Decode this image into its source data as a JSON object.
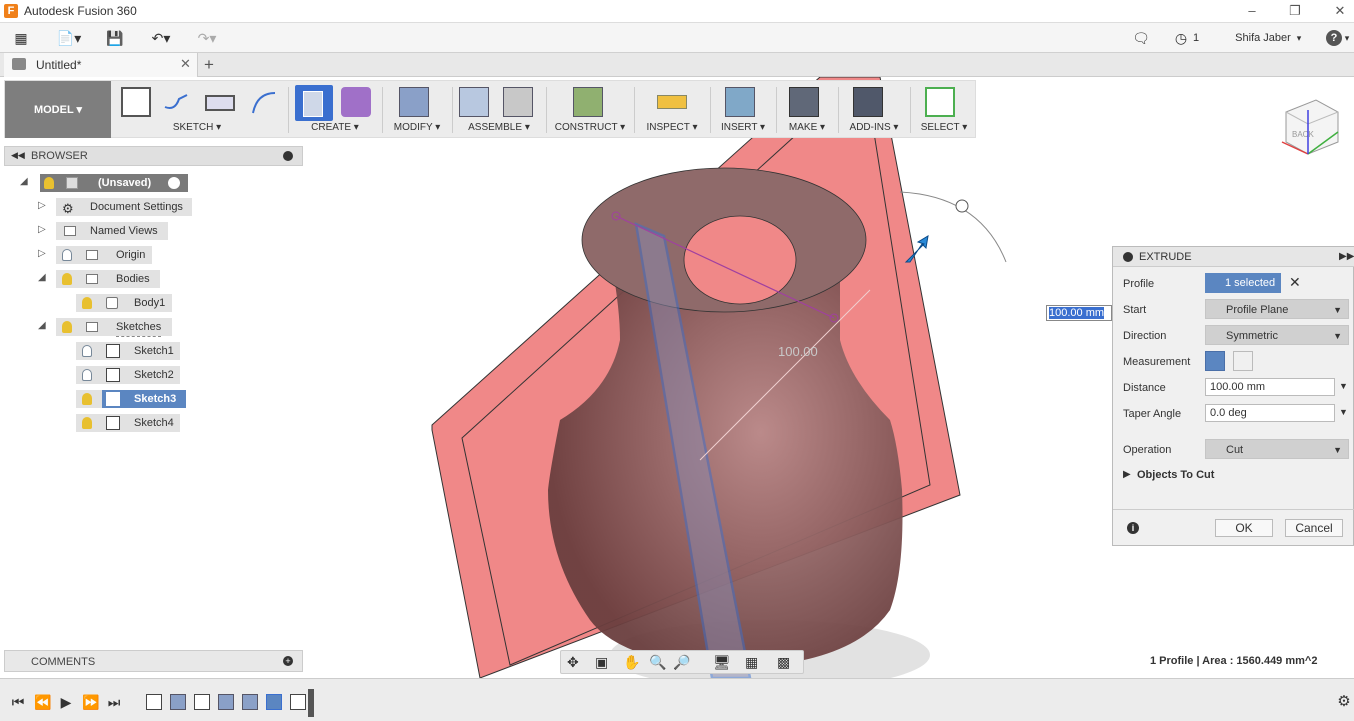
{
  "window": {
    "title": "Autodesk Fusion 360",
    "logo": "F"
  },
  "appbar": {
    "notifications_count": "1",
    "user": "Shifa Jaber",
    "help": "?"
  },
  "document": {
    "tab_title": "Untitled*"
  },
  "toolbar": {
    "workspace": "MODEL",
    "groups": [
      "SKETCH",
      "CREATE",
      "MODIFY",
      "ASSEMBLE",
      "CONSTRUCT",
      "INSPECT",
      "INSERT",
      "MAKE",
      "ADD-INS",
      "SELECT"
    ]
  },
  "browser": {
    "header": "BROWSER",
    "root": "(Unsaved)",
    "items": {
      "document_settings": "Document Settings",
      "named_views": "Named Views",
      "origin": "Origin",
      "bodies": "Bodies",
      "body1": "Body1",
      "sketches": "Sketches",
      "sketch1": "Sketch1",
      "sketch2": "Sketch2",
      "sketch3": "Sketch3",
      "sketch4": "Sketch4"
    }
  },
  "comments": {
    "header": "COMMENTS"
  },
  "extrude": {
    "title": "EXTRUDE",
    "profile_label": "Profile",
    "profile_value": "1 selected",
    "start_label": "Start",
    "start_value": "Profile Plane",
    "direction_label": "Direction",
    "direction_value": "Symmetric",
    "measurement_label": "Measurement",
    "distance_label": "Distance",
    "distance_value": "100.00 mm",
    "taper_label": "Taper Angle",
    "taper_value": "0.0 deg",
    "operation_label": "Operation",
    "operation_value": "Cut",
    "objects_label": "Objects To Cut",
    "ok": "OK",
    "cancel": "Cancel"
  },
  "viewport": {
    "dim_input": "100.00 mm",
    "dim_label": "100.00",
    "status": "1 Profile | Area : 1560.449 mm^2",
    "viewcube_face": "BACK"
  },
  "colors": {
    "accent": "#5b86c1",
    "plane": "#f08080",
    "body": "#8a5a5a"
  }
}
